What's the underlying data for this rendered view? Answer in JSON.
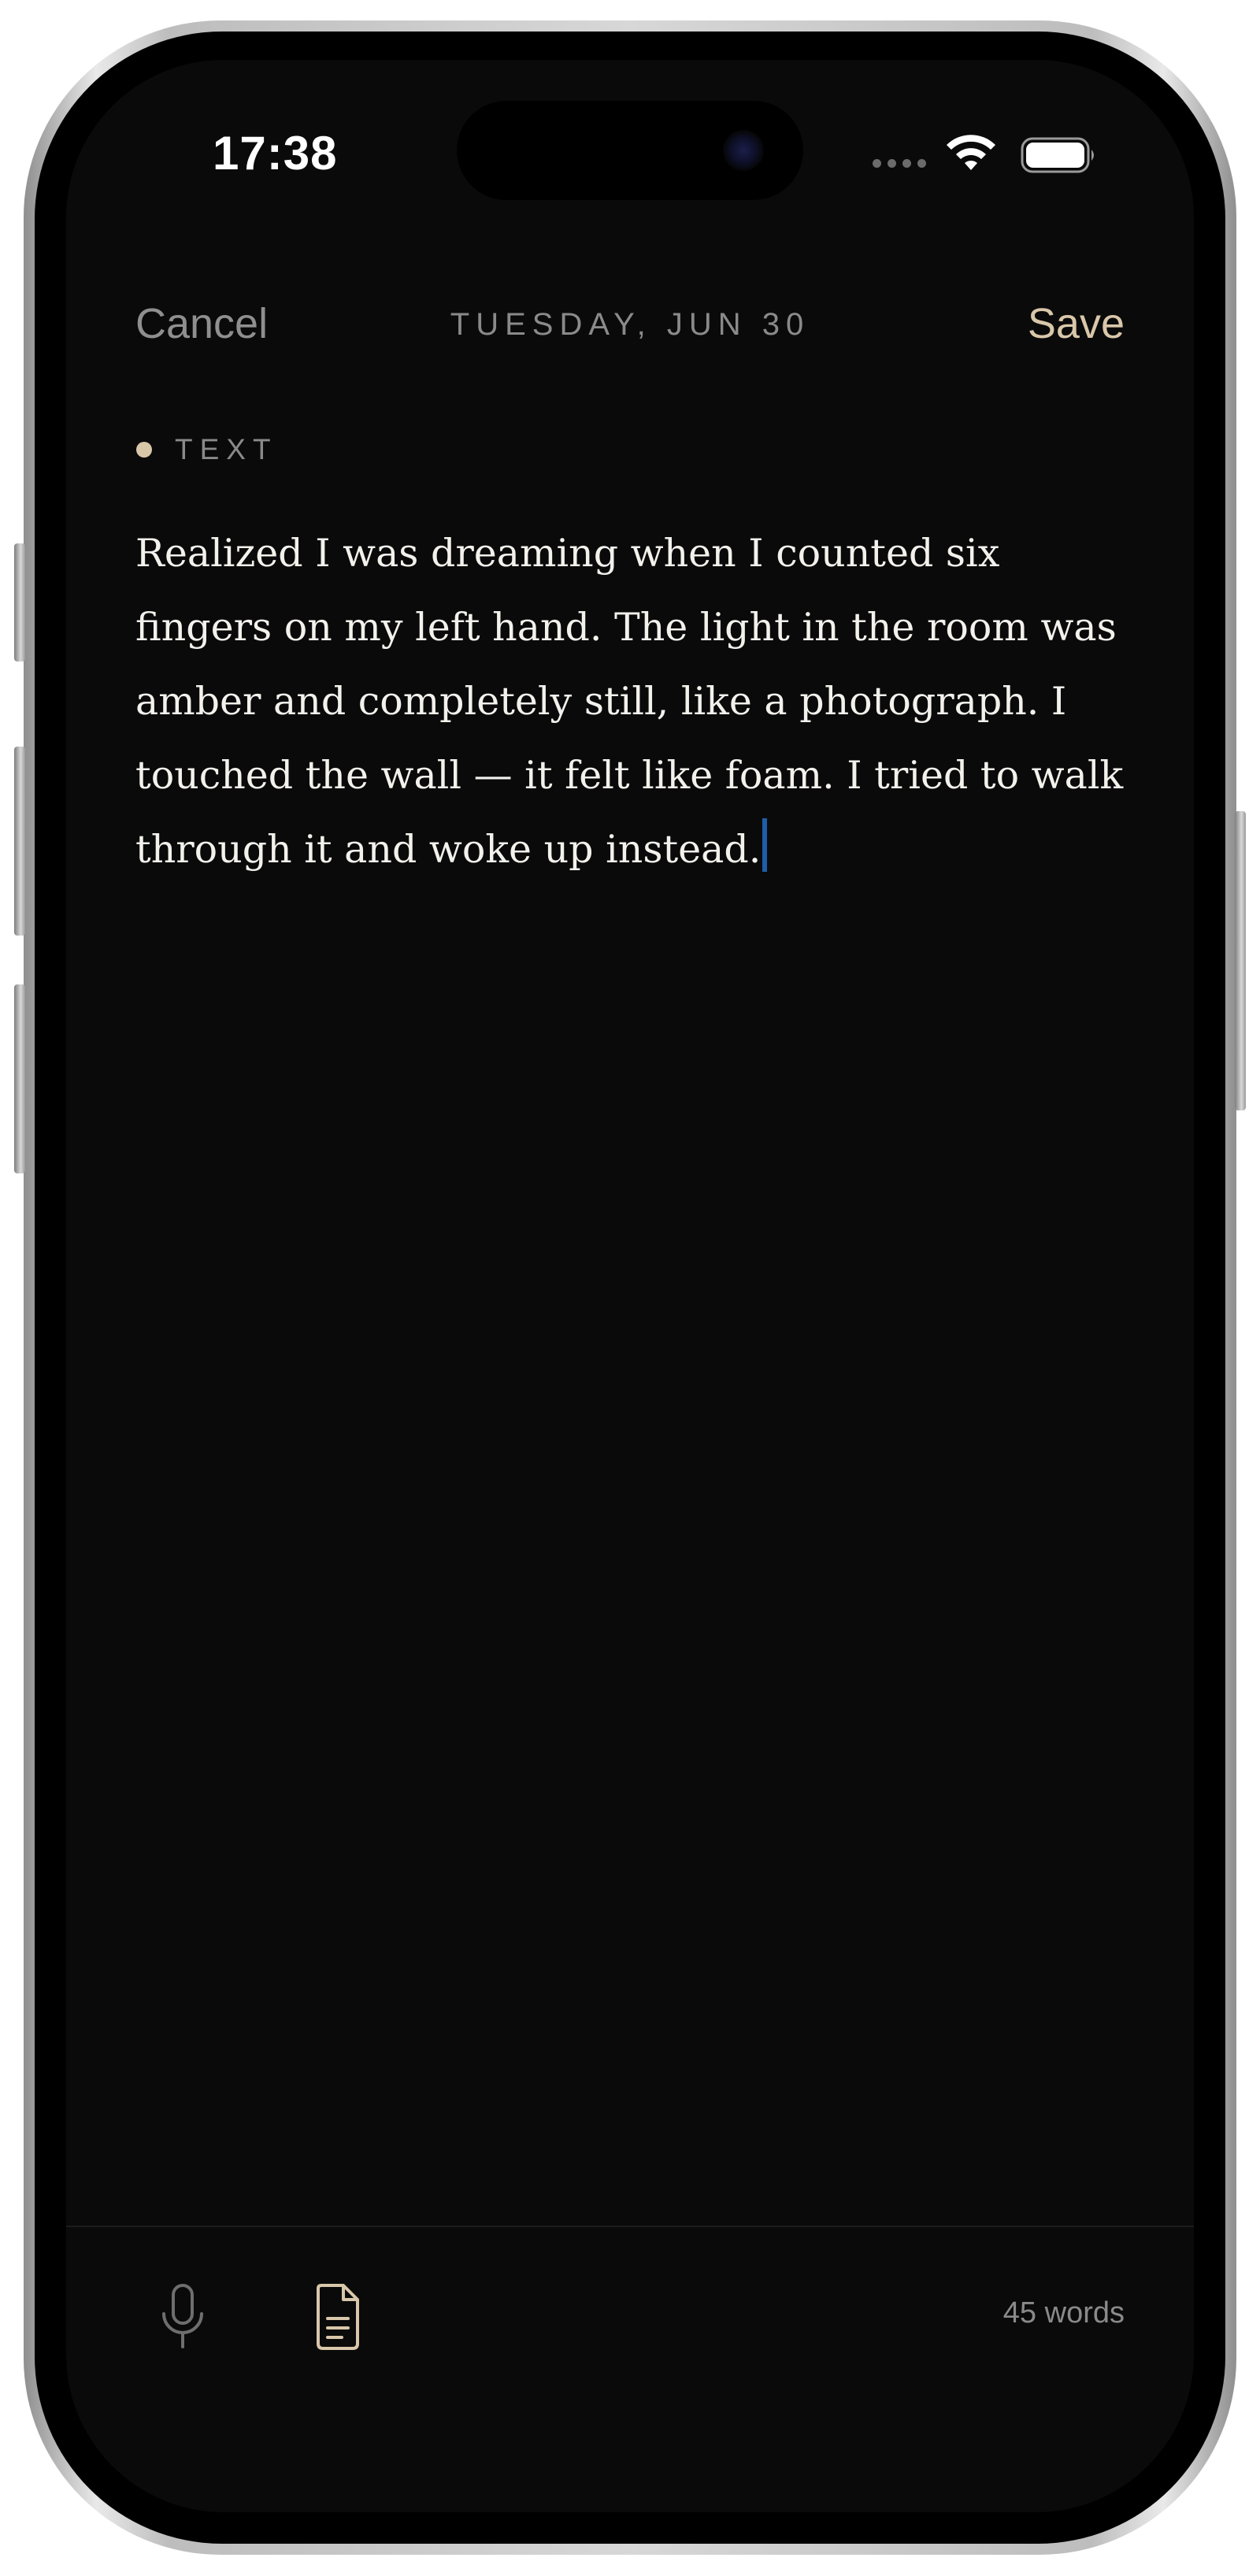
{
  "status_bar": {
    "time": "17:38",
    "wifi_icon": "wifi-icon",
    "battery_icon": "battery-icon"
  },
  "header": {
    "cancel_label": "Cancel",
    "date": "TUESDAY, JUN 30",
    "save_label": "Save"
  },
  "entry": {
    "mode_label": "TEXT",
    "text": "Realized I was dreaming when I counted six fingers on my left hand. The light in the room was amber and completely still, like a photograph. I touched the wall — it felt like foam. I tried to walk through it and woke up instead."
  },
  "toolbar": {
    "mic_icon": "microphone-icon",
    "doc_icon": "document-icon",
    "word_count": "45 words"
  },
  "colors": {
    "background": "#0a0a0a",
    "accent": "#d9c7aa",
    "muted": "#8a8a8a",
    "caret": "#1e5ea8"
  }
}
